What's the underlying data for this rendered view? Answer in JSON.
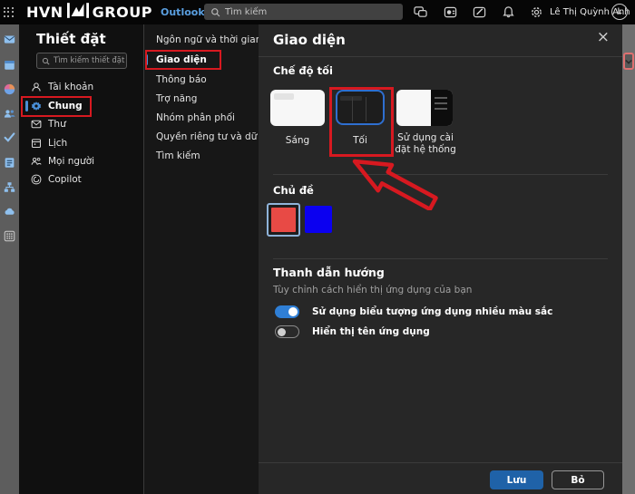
{
  "topbar": {
    "logo_text_1": "HVN",
    "logo_text_2": "GROUP",
    "app_name": "Outlook",
    "search_placeholder": "Tìm kiếm",
    "user_name": "Lê Thị Quỳnh Anh",
    "avatar_initial": "L",
    "close_glyph": "×"
  },
  "rail_icons": [
    "mail",
    "calendar",
    "microsoft-365",
    "people",
    "todo",
    "notes",
    "org-chart",
    "onedrive",
    "more-apps"
  ],
  "settings_nav": {
    "title": "Thiết đặt",
    "search_placeholder": "Tìm kiếm thiết đặt",
    "items": [
      {
        "label": "Tài khoản",
        "icon": "person-icon",
        "selected": false
      },
      {
        "label": "Chung",
        "icon": "gear-icon",
        "selected": true
      },
      {
        "label": "Thư",
        "icon": "mail-icon",
        "selected": false
      },
      {
        "label": "Lịch",
        "icon": "calendar-icon",
        "selected": false
      },
      {
        "label": "Mọi người",
        "icon": "people-icon",
        "selected": false
      },
      {
        "label": "Copilot",
        "icon": "copilot-icon",
        "selected": false
      }
    ]
  },
  "subnav": {
    "items": [
      {
        "label": "Ngôn ngữ và thời gian",
        "selected": false
      },
      {
        "label": "Giao diện",
        "selected": true
      },
      {
        "label": "Thông báo",
        "selected": false
      },
      {
        "label": "Trợ năng",
        "selected": false
      },
      {
        "label": "Nhóm phân phối",
        "selected": false
      },
      {
        "label": "Quyền riêng tư và dữ liệu",
        "selected": false
      },
      {
        "label": "Tìm kiếm",
        "selected": false
      }
    ]
  },
  "panel": {
    "title": "Giao diện",
    "dark_mode": {
      "heading": "Chế độ tối",
      "options": [
        {
          "label": "Sáng",
          "selected": false
        },
        {
          "label": "Tối",
          "selected": true
        },
        {
          "label": "Sử dụng cài đặt hệ thống",
          "selected": false
        }
      ]
    },
    "theme": {
      "heading": "Chủ đề",
      "swatches": [
        {
          "color": "#e84a45",
          "selected": true
        },
        {
          "color": "#0b00f0",
          "selected": false
        }
      ]
    },
    "nav_bar": {
      "heading": "Thanh dẫn hướng",
      "subtitle": "Tùy chỉnh cách hiển thị ứng dụng của bạn",
      "toggles": [
        {
          "label": "Sử dụng biểu tượng ứng dụng nhiều màu sắc",
          "on": true
        },
        {
          "label": "Hiển thị tên ứng dụng",
          "on": false
        }
      ]
    },
    "footer": {
      "save_label": "Lưu",
      "discard_label": "Bỏ"
    }
  },
  "colors": {
    "annotation_red": "#d71920",
    "selected_card_border": "#2e6fd0",
    "accent_blue": "#2f7fd6",
    "save_button_blue": "#1f62a8"
  }
}
